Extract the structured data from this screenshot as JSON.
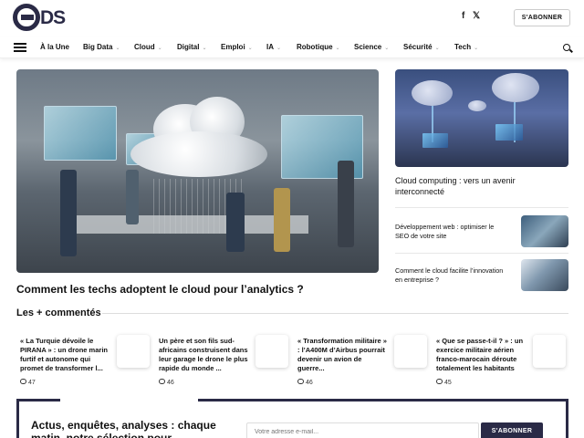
{
  "brand": {
    "logo_text": "DS"
  },
  "header": {
    "social": [
      {
        "name": "facebook",
        "glyph": "f"
      },
      {
        "name": "x",
        "glyph": "𝕏"
      }
    ],
    "subscribe_label": "S'ABONNER"
  },
  "nav": {
    "items": [
      {
        "label": "À la Une",
        "has_menu": false
      },
      {
        "label": "Big Data",
        "has_menu": true
      },
      {
        "label": "Cloud",
        "has_menu": true
      },
      {
        "label": "Digital",
        "has_menu": true
      },
      {
        "label": "Emploi",
        "has_menu": true
      },
      {
        "label": "IA",
        "has_menu": true
      },
      {
        "label": "Robotique",
        "has_menu": true
      },
      {
        "label": "Science",
        "has_menu": true
      },
      {
        "label": "Sécurité",
        "has_menu": true
      },
      {
        "label": "Tech",
        "has_menu": true
      }
    ]
  },
  "hero": {
    "title": "Comment les techs adoptent le cloud pour l’analytics ?"
  },
  "side": {
    "main_title": "Cloud computing : vers un avenir interconnecté",
    "items": [
      {
        "title": "Développement web : optimiser le SEO de votre site"
      },
      {
        "title": "Comment le cloud facilite l’innovation en entreprise ?"
      }
    ]
  },
  "most_commented": {
    "title": "Les + commentés",
    "items": [
      {
        "title": "« La Turquie dévoile le PIRANA » : un drone marin furtif et autonome qui promet de transformer l...",
        "comments": "47"
      },
      {
        "title": "Un père et son fils sud-africains construisent dans leur garage le drone le plus rapide du monde ...",
        "comments": "46"
      },
      {
        "title": "« Transformation militaire » : l’A400M d’Airbus pourrait devenir un avion de guerre...",
        "comments": "46"
      },
      {
        "title": "« Que se passe-t-il ? » : un exercice militaire aérien franco-marocain déroute totalement les habitants",
        "comments": "45"
      }
    ]
  },
  "newsletter": {
    "title": "Actus, enquêtes, analyses : chaque matin, notre sélection pour",
    "placeholder": "Votre adresse e-mail...",
    "button_label": "S'ABONNER"
  },
  "colors": {
    "brand": "#2a2a46"
  }
}
